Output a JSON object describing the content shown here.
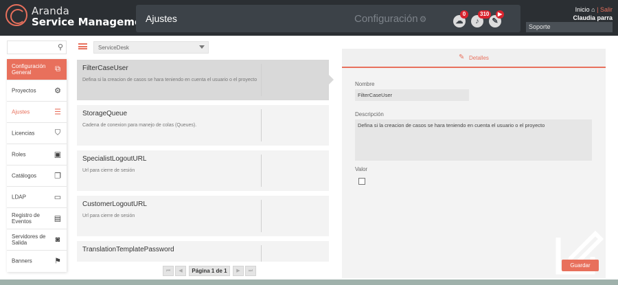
{
  "brand": {
    "line1": "Aranda",
    "line2": "Service Management"
  },
  "header": {
    "title": "Ajustes",
    "section": "Configuración",
    "icons": [
      {
        "name": "cloud-icon",
        "badge": "0"
      },
      {
        "name": "bell-icon",
        "badge": "310"
      },
      {
        "name": "tools-icon",
        "badge": "▶"
      }
    ]
  },
  "user": {
    "inicio": "Inicio",
    "separator": "|",
    "salir": "Salir",
    "name": "Claudia parra",
    "project": "Soporte"
  },
  "sidebar": {
    "items": [
      {
        "label": "Configuración General",
        "icon": "config-icon",
        "state": "active"
      },
      {
        "label": "Proyectos",
        "icon": "gear-icon",
        "state": ""
      },
      {
        "label": "Ajustes",
        "icon": "sliders-icon",
        "state": "current"
      },
      {
        "label": "Licencias",
        "icon": "shield-icon",
        "state": ""
      },
      {
        "label": "Roles",
        "icon": "id-card-icon",
        "state": ""
      },
      {
        "label": "Catálogos",
        "icon": "catalog-icon",
        "state": ""
      },
      {
        "label": "LDAP",
        "icon": "folder-icon",
        "state": ""
      },
      {
        "label": "Registro de Eventos",
        "icon": "clipboard-icon",
        "state": ""
      },
      {
        "label": "Servidores de Salida",
        "icon": "server-icon",
        "state": ""
      },
      {
        "label": "Banners",
        "icon": "flag-icon",
        "state": ""
      }
    ]
  },
  "list": {
    "dropdown_value": "ServiceDesk",
    "items": [
      {
        "title": "FilterCaseUser",
        "description": "Defina si la creacion de casos se hara teniendo en cuenta el usuario o el proyecto"
      },
      {
        "title": "StorageQueue",
        "description": "Cadena de conexion para manejo de colas (Queues)."
      },
      {
        "title": "SpecialistLogoutURL",
        "description": "Url para cierre de sesión"
      },
      {
        "title": "CustomerLogoutURL",
        "description": "Url para cierre de sesión"
      },
      {
        "title": "TranslationTemplatePassword",
        "description": ""
      }
    ],
    "pager": {
      "first": "⏮",
      "prev": "◀",
      "label": "Página 1 de 1",
      "next": "▶",
      "last": "⏭"
    }
  },
  "detail": {
    "tab": "Detalles",
    "name_label": "Nombre",
    "name_value": "FilterCaseUser",
    "description_label": "Descripción",
    "description_value": "Defina si la creacion de casos se hara teniendo en cuenta el usuario o el proyecto",
    "value_label": "Valor",
    "value_checked": false,
    "save_label": "Guardar"
  },
  "colors": {
    "accent": "#e8705c",
    "header_bg": "#2b2f33",
    "header_bar": "#3c4248",
    "badge": "#d9232e",
    "footer": "#9fb1ab"
  }
}
